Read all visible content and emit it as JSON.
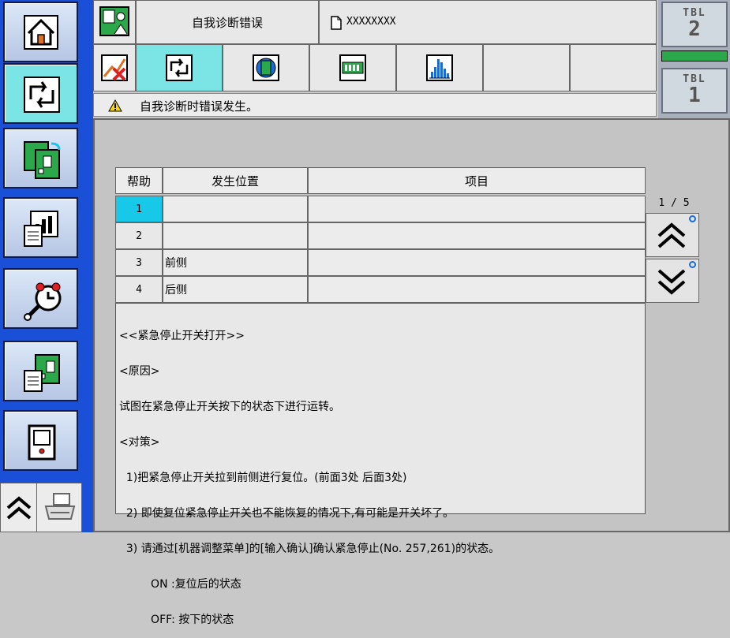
{
  "header": {
    "title": "自我诊断错误",
    "file_name": "XXXXXXXX",
    "tabs": [
      {
        "icon": "error-graph-icon"
      },
      {
        "icon": "cycle-icon"
      },
      {
        "icon": "board-icon"
      },
      {
        "icon": "io-panel-icon"
      },
      {
        "icon": "histogram-icon"
      },
      {
        "icon": ""
      },
      {
        "icon": ""
      }
    ]
  },
  "message": {
    "icon": "warning-icon",
    "text": "自我诊断时错误发生。"
  },
  "tbl": {
    "top": {
      "label": "TBL",
      "number": "2"
    },
    "bottom": {
      "label": "TBL",
      "number": "1"
    }
  },
  "sidebar": {
    "items": [
      {
        "icon": "home-icon"
      },
      {
        "icon": "cycle-icon",
        "active": true
      },
      {
        "icon": "board-copy-icon"
      },
      {
        "icon": "report-chart-icon"
      },
      {
        "icon": "alarm-maintenance-icon"
      },
      {
        "icon": "board-document-icon"
      },
      {
        "icon": "machine-icon"
      }
    ]
  },
  "table": {
    "headers": {
      "help": "帮助",
      "location": "发生位置",
      "item": "项目"
    },
    "rows": [
      {
        "num": "1",
        "location": "",
        "item": ""
      },
      {
        "num": "2",
        "location": "",
        "item": ""
      },
      {
        "num": "3",
        "location": "前侧",
        "item": ""
      },
      {
        "num": "4",
        "location": "后侧",
        "item": ""
      }
    ],
    "selected_row": 1
  },
  "pager": {
    "text": "1 / 5"
  },
  "help_text": {
    "lines": [
      "<<紧急停止开关打开>>",
      "<原因>",
      "试图在紧急停止开关按下的状态下进行运转。",
      "<对策>",
      "  1)把紧急停止开关拉到前侧进行复位。(前面3处 后面3处)",
      "  2) 即使复位紧急停止开关也不能恢复的情况下,有可能是开关坏了。",
      "  3) 请通过[机器调整菜单]的[输入确认]确认紧急停止(No. 257,261)的状态。",
      "         ON :复位后的状态",
      "         OFF: 按下的状态"
    ]
  }
}
